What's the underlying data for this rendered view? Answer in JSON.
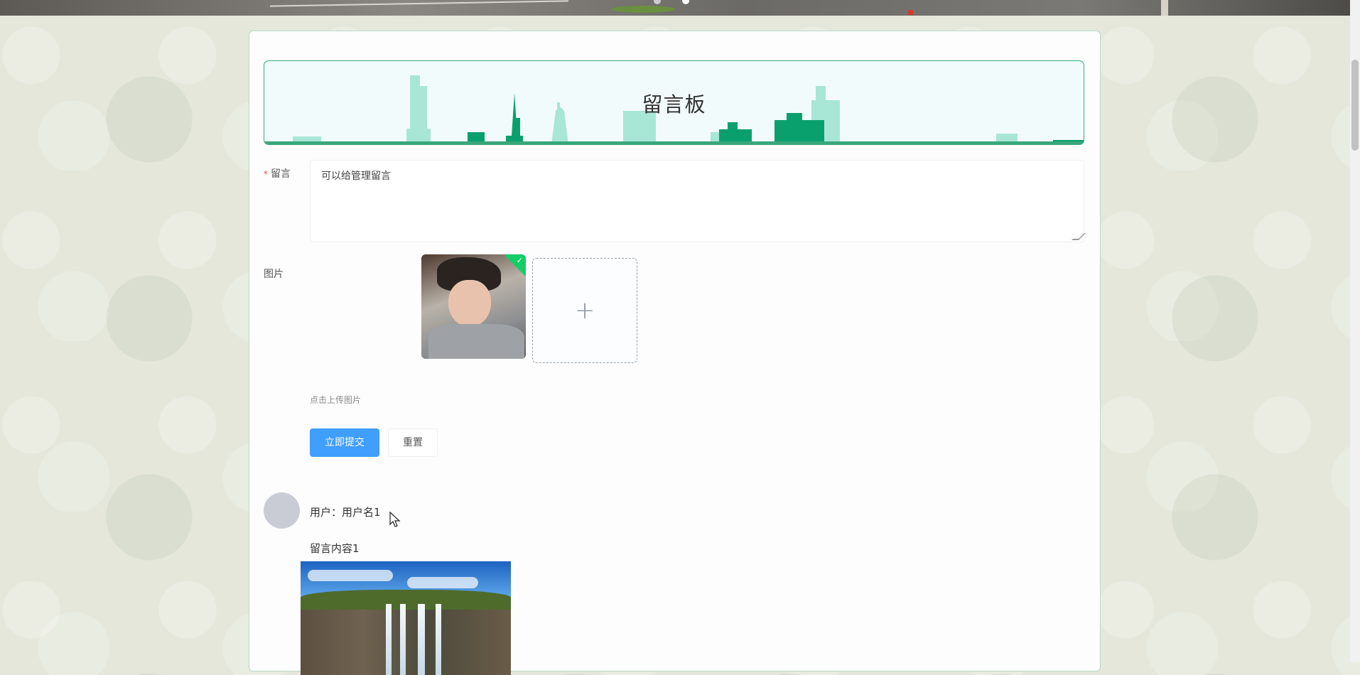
{
  "form": {
    "title": "留言板",
    "message_label": "留言",
    "message_required_mark": "*",
    "message_value": "可以给管理留言",
    "image_label": "图片",
    "upload_hint": "点击上传图片",
    "upload_plus": "+",
    "submit_label": "立即提交",
    "reset_label": "重置"
  },
  "messages": [
    {
      "user_text": "用户：用户名1",
      "content": "留言内容1"
    }
  ],
  "colors": {
    "accent": "#409eff",
    "header_border": "#3aa77b",
    "skyline": "#0aa06e",
    "skyline_light": "#a8e6d6"
  },
  "icons": {
    "upload": "plus-icon",
    "uploaded": "check-icon"
  }
}
